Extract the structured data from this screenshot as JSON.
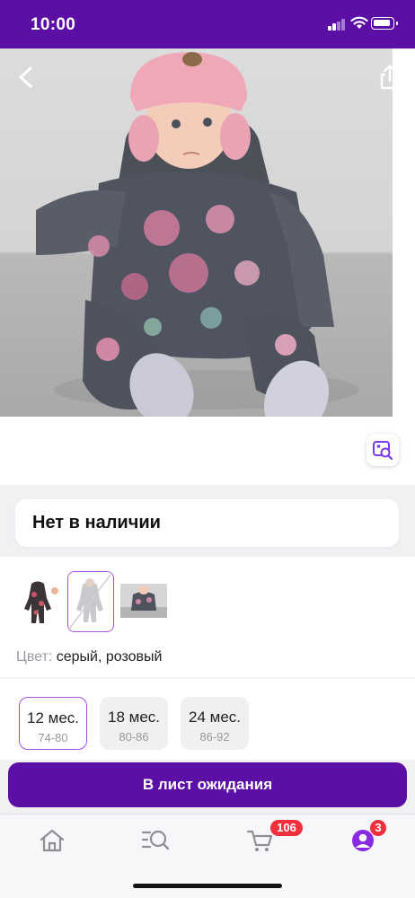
{
  "status_bar": {
    "time": "10:00"
  },
  "product": {
    "stock_status": "Нет в наличии",
    "color_label": "Цвет:",
    "color_value": "серый, розовый"
  },
  "sizes": [
    {
      "label": "12 мес.",
      "sub": "74-80",
      "selected": true
    },
    {
      "label": "18 мес.",
      "sub": "80-86",
      "selected": false
    },
    {
      "label": "24 мес.",
      "sub": "86-92",
      "selected": false
    }
  ],
  "actions": {
    "waitlist_label": "В лист ожидания"
  },
  "tabbar": {
    "cart_badge": "106",
    "profile_badge": "3"
  },
  "colors": {
    "brand": "#5b0fa5",
    "accent_border": "#a74fe0",
    "badge": "#f0303c"
  },
  "icons": [
    "back-icon",
    "share-icon",
    "visual-search-icon",
    "home-icon",
    "catalog-search-icon",
    "cart-icon",
    "profile-icon"
  ]
}
